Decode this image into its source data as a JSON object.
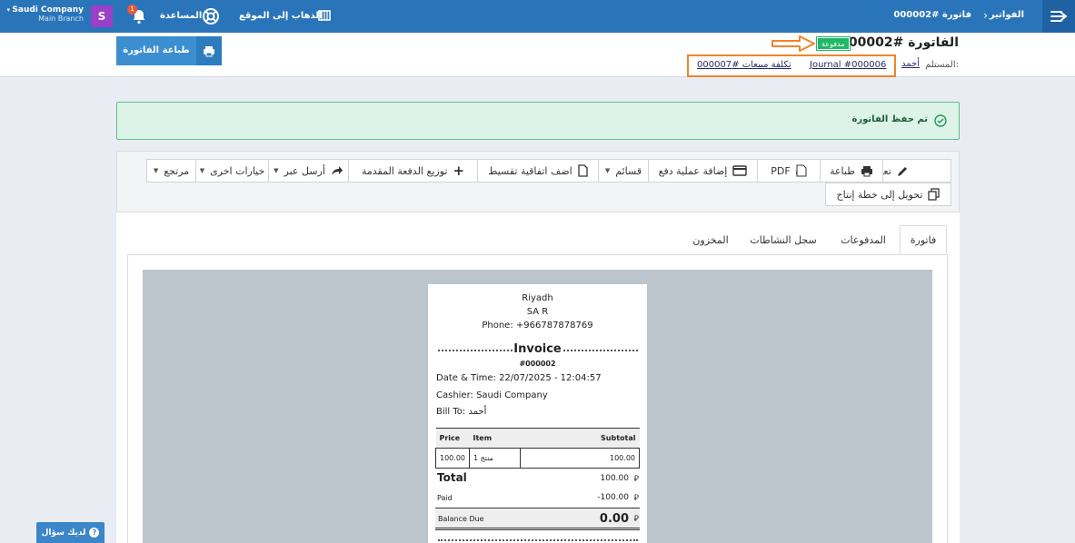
{
  "topbar": {
    "breadcrumb_root": "الفواتير",
    "breadcrumb_current": "فاتورة #000002",
    "goto_site": "الذهاب إلى الموقع",
    "help": "المساعدة",
    "notification_count": "1",
    "avatar_letter": "S",
    "company_name": "Saudi Company",
    "branch_name": "Main Branch"
  },
  "header": {
    "title": "الفاتورة #000002",
    "status_badge": "مدفوعة",
    "recipient_label": "المستلم:",
    "recipient_name": "أحمد",
    "journal_link": "Journal #000006",
    "cost_link": "تكلفة مبيعات #000007",
    "print_button": "طباعة الفاتورة"
  },
  "alert": {
    "message": "تم حفظ الفاتورة"
  },
  "toolbar": {
    "edit": "تعديل",
    "print": "طباعة",
    "pdf": "PDF",
    "add_payment": "إضافة عملية دفع",
    "lists": "قسائم",
    "add_installment": "اضف اتفاقية تقسيط",
    "distribute_payment": "توزيع الدفعة المقدمة",
    "send_via": "أرسل عبر",
    "other_options": "خيارات اخرى",
    "returned": "مرتجع",
    "convert_production": "تحويل إلى خطة إنتاج"
  },
  "tabs": [
    "فاتورة",
    "المدفوعات",
    "سجل النشاطات",
    "المخزون"
  ],
  "receipt": {
    "city": "Riyadh",
    "country": "SA R",
    "phone": "Phone: +966787878769",
    "heading": "Invoice",
    "number": "#000002",
    "datetime": "Date & Time: 22/07/2025 - 12:04:57",
    "cashier": "Cashier: Saudi Company",
    "bill_to": "Bill To: أحمد",
    "table_headers": {
      "price": "Price",
      "item": "Item",
      "subtotal": "Subtotal"
    },
    "rows": [
      {
        "price": "100.00",
        "item": "منتج 1",
        "subtotal": "100.00"
      }
    ],
    "total_label": "Total",
    "total_value": "100.00",
    "paid_label": "Paid",
    "paid_value": "-100.00",
    "balance_label": "Balance Due",
    "balance_value": "0.00",
    "currency_symbol": "⃁"
  },
  "help_button": "لديك سؤال",
  "colors": {
    "topbar": "#2a75ba",
    "accent_button": "#3b8fd1",
    "badge_green": "#1fb866",
    "annotation_orange": "#f0842c",
    "avatar": "#9b3ec8"
  }
}
